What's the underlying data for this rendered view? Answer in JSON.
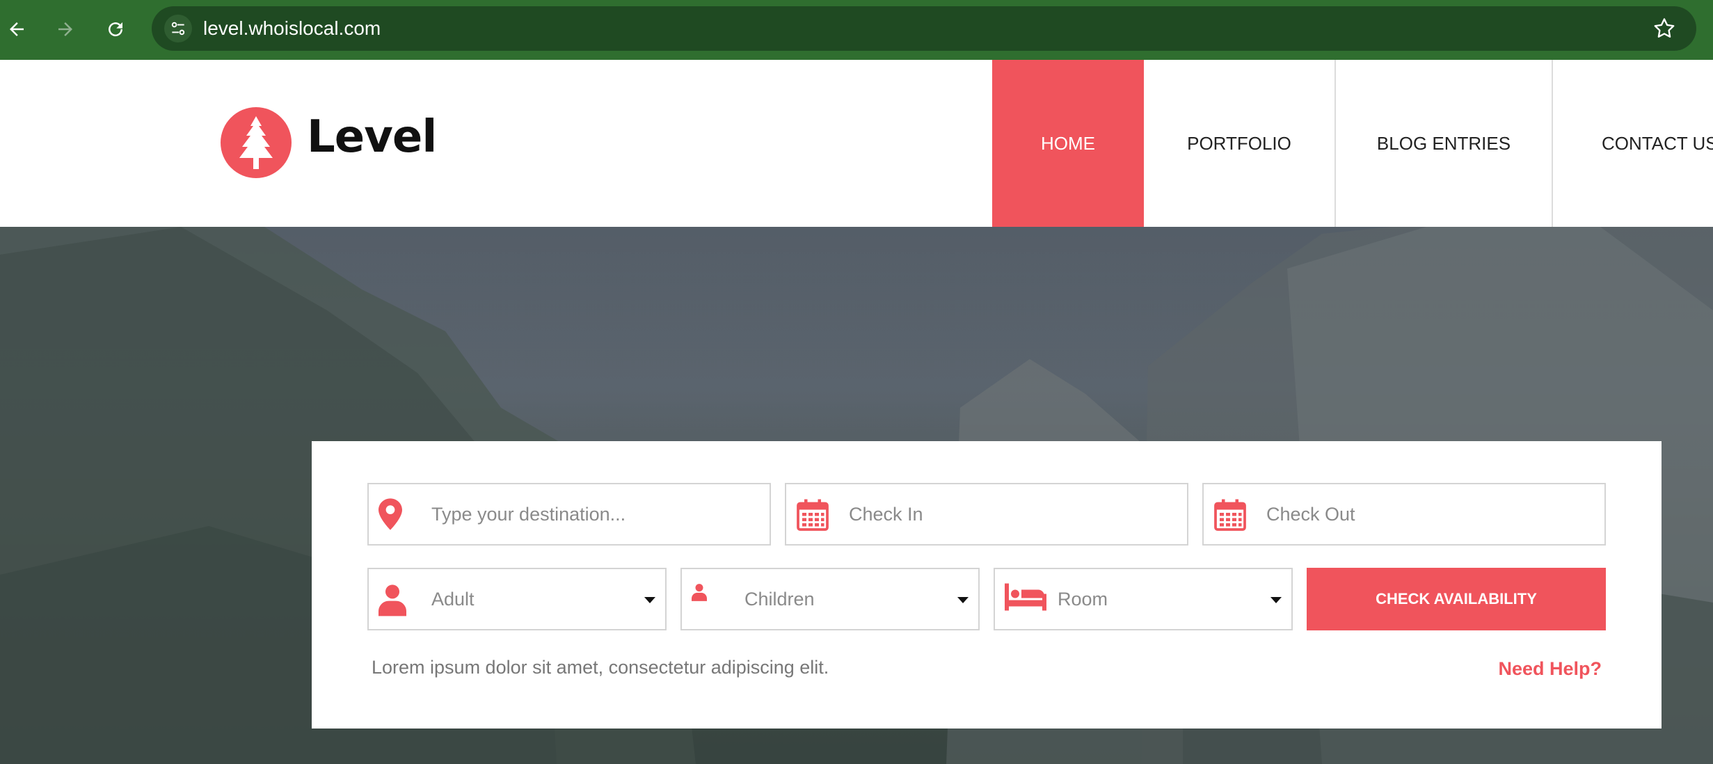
{
  "browser": {
    "url": "level.whoislocal.com",
    "icons": [
      "back-arrow-icon",
      "forward-arrow-icon",
      "reload-icon",
      "site-settings-icon",
      "bookmark-star-icon"
    ]
  },
  "site": {
    "logo_text": "Level",
    "brand_color": "#f0545c",
    "nav": [
      {
        "label": "HOME",
        "active": true
      },
      {
        "label": "PORTFOLIO",
        "active": false
      },
      {
        "label": "BLOG ENTRIES",
        "active": false
      },
      {
        "label": "CONTACT US",
        "active": false
      }
    ]
  },
  "search": {
    "destination_placeholder": "Type your destination...",
    "checkin_placeholder": "Check In",
    "checkout_placeholder": "Check Out",
    "adult_value": "Adult",
    "children_value": "Children",
    "room_value": "Room",
    "button_label": "CHECK AVAILABILITY",
    "tagline": "Lorem ipsum dolor sit amet, consectetur adipiscing elit.",
    "help_link": "Need Help?"
  }
}
